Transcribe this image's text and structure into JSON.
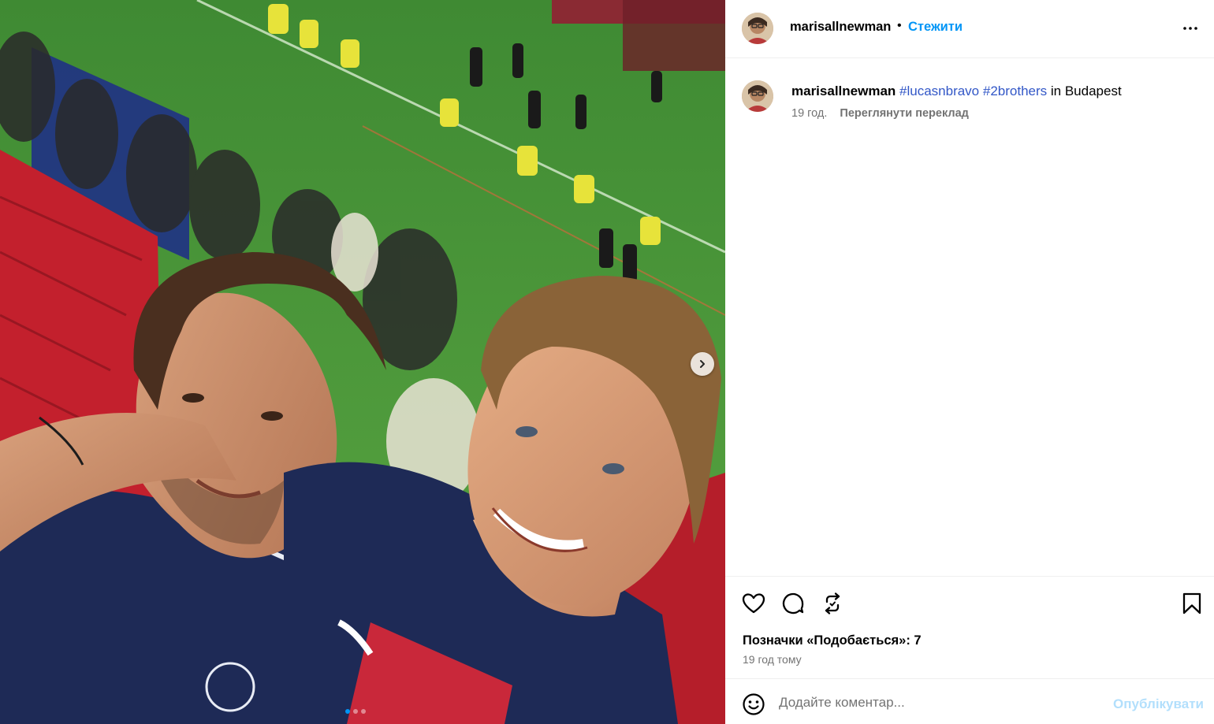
{
  "post": {
    "username": "marisallnewman",
    "separator": "•",
    "follow_label": "Стежити",
    "more_icon": "more-horizontal-icon"
  },
  "caption": {
    "username": "marisallnewman",
    "hashtag_1": "#lucasnbravo",
    "hashtag_2": "#2brothers",
    "location_text": "in Budapest",
    "age": "19 год.",
    "translate_label": "Переглянути переклад"
  },
  "media": {
    "next_icon": "chevron-right-icon",
    "carousel_count": 3,
    "carousel_active": 1,
    "colors": {
      "pitch": "#4f9a3b",
      "seats": "#c3202d",
      "jersey": "#1e2a56"
    }
  },
  "actions": {
    "like_icon": "heart-icon",
    "comment_icon": "comment-icon",
    "share_icon": "repost-icon",
    "save_icon": "bookmark-icon",
    "likes_text": "Позначки «Подобається»: 7",
    "time_text": "19 год тому"
  },
  "comment": {
    "emoji_icon": "smiley-icon",
    "placeholder": "Додайте коментар...",
    "post_label": "Опублікувати"
  },
  "colors": {
    "accent": "#0095f6",
    "muted_text": "#737373",
    "post_disabled": "#b2dffc"
  }
}
